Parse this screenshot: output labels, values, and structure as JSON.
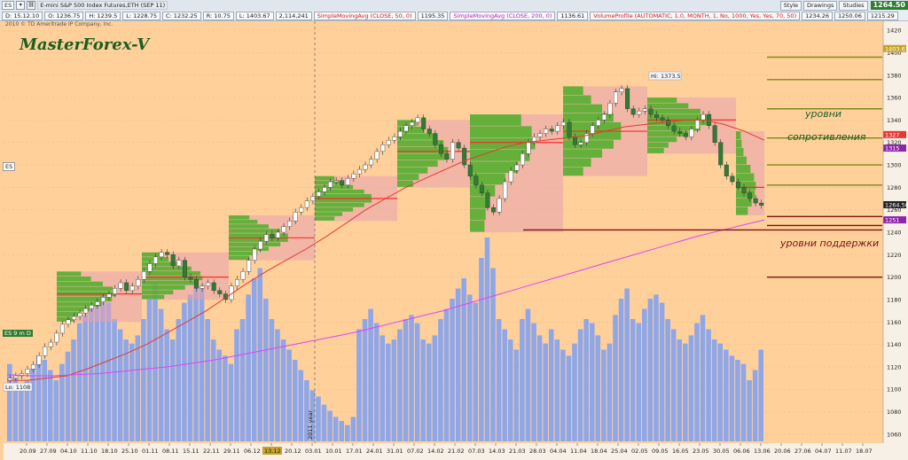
{
  "toolbar": {
    "symbol_code": "ES",
    "symbol_desc": "E-mini S&P 500 Index Futures,ETH (SEP 11)",
    "date_label": "D: 15.12.10",
    "open_label": "O: 1236.75",
    "high_label": "H: 1239.5",
    "low_label": "L: 1228.75",
    "close_label": "C: 1232.25",
    "range_label": "R: 10.75",
    "last_label": "L: 1403.67",
    "volume_value": "2,114,241",
    "sma50_study": "SimpleMovingAvg (CLOSE, 50, 0)",
    "sma50_value": "1195.35",
    "sma200_study": "SimpleMovingAvg (CLOSE, 200, 0)",
    "sma200_value": "1136.61",
    "vp_study": "VolumeProfile (AUTOMATIC, 1.0, MONTH, 1, No, 1000, Yes, Yes, 70, 50)",
    "vp_value1": "1234.26",
    "vp_value2": "1250.06",
    "vp_value3": "1215.29",
    "style_button": "Style",
    "drawings_button": "Drawings",
    "studies_button": "Studies",
    "last_price_badge": "1264.50",
    "symbol_selector": "ES",
    "timeframe_badge": "ES 9 m D",
    "copyright": "2010 © TD Ameritrade IP Company, Inc."
  },
  "overlay": {
    "brand": "MasterForex-V",
    "resistance_label_1": "уровни",
    "resistance_label_2": "сопротивления",
    "support_label": "уровни поддержки",
    "hi_label": "Hi: 1373.5",
    "lo_label": "Lo: 1108",
    "year_label": "2011 year"
  },
  "colors": {
    "background": "#ffd09a",
    "candle": "#2e7d32",
    "volume": "#8fa6e8",
    "sma50": "#e53935",
    "sma200": "#e040fb",
    "vp_green": "#4caf28",
    "vp_pink": "#e8a0b0",
    "resistance": "#7a8a1a",
    "support": "#7b1212"
  },
  "chart_data": {
    "type": "candlestick",
    "y_axis_ticks": [
      1420,
      1400,
      1380,
      1360,
      1340,
      1320,
      1300,
      1280,
      1260,
      1240,
      1220,
      1200,
      1180,
      1160,
      1140,
      1120,
      1100,
      1080,
      1060
    ],
    "ylim": [
      1052,
      1428
    ],
    "x_axis_ticks": [
      "20.09",
      "27.09",
      "04.10",
      "11.10",
      "18.10",
      "25.10",
      "01.11",
      "08.11",
      "15.11",
      "22.11",
      "29.11",
      "06.12",
      "13.12",
      "20.12",
      "03.01",
      "10.01",
      "17.01",
      "24.01",
      "31.01",
      "07.02",
      "14.02",
      "21.02",
      "07.03",
      "14.03",
      "21.03",
      "28.03",
      "04.04",
      "11.04",
      "18.04",
      "25.04",
      "02.05",
      "09.05",
      "16.05",
      "23.05",
      "30.05",
      "06.06",
      "13.06",
      "20.06",
      "27.06",
      "04.07",
      "11.07",
      "18.07"
    ],
    "highlight_tick": "13.12",
    "close_series": [
      1110,
      1112,
      1114,
      1118,
      1122,
      1130,
      1138,
      1142,
      1150,
      1158,
      1162,
      1165,
      1168,
      1172,
      1175,
      1178,
      1182,
      1185,
      1190,
      1195,
      1188,
      1192,
      1198,
      1205,
      1212,
      1218,
      1222,
      1220,
      1210,
      1215,
      1200,
      1198,
      1190,
      1192,
      1195,
      1188,
      1185,
      1180,
      1192,
      1198,
      1205,
      1215,
      1225,
      1232,
      1238,
      1235,
      1240,
      1245,
      1250,
      1258,
      1262,
      1268,
      1272,
      1276,
      1280,
      1285,
      1286,
      1282,
      1288,
      1292,
      1296,
      1300,
      1305,
      1312,
      1318,
      1322,
      1325,
      1330,
      1335,
      1338,
      1342,
      1332,
      1328,
      1318,
      1310,
      1305,
      1320,
      1315,
      1300,
      1290,
      1282,
      1275,
      1262,
      1258,
      1270,
      1285,
      1295,
      1300,
      1310,
      1320,
      1325,
      1328,
      1332,
      1330,
      1335,
      1338,
      1325,
      1318,
      1320,
      1328,
      1335,
      1340,
      1345,
      1355,
      1365,
      1368,
      1350,
      1345,
      1348,
      1350,
      1345,
      1342,
      1340,
      1335,
      1330,
      1328,
      1325,
      1332,
      1340,
      1345,
      1335,
      1320,
      1300,
      1290,
      1285,
      1280,
      1275,
      1270,
      1266,
      1264
    ],
    "sma50_series": [
      1108,
      1108,
      1110,
      1112,
      1118,
      1125,
      1132,
      1140,
      1150,
      1160,
      1170,
      1182,
      1194,
      1205,
      1215,
      1225,
      1236,
      1248,
      1260,
      1270,
      1280,
      1288,
      1296,
      1304,
      1310,
      1316,
      1320,
      1322,
      1324,
      1326,
      1330,
      1334,
      1336,
      1338,
      1340,
      1340,
      1336,
      1330,
      1322
    ],
    "sma200_series": [
      1113,
      1112,
      1112,
      1113,
      1114,
      1116,
      1118,
      1120,
      1123,
      1126,
      1130,
      1134,
      1138,
      1142,
      1146,
      1150,
      1155,
      1160,
      1165,
      1170,
      1176,
      1182,
      1188,
      1194,
      1200,
      1206,
      1212,
      1218,
      1224,
      1230,
      1236,
      1241,
      1246,
      1251
    ],
    "volume_series": [
      38,
      32,
      28,
      30,
      36,
      42,
      40,
      35,
      30,
      38,
      44,
      50,
      58,
      62,
      65,
      70,
      72,
      68,
      60,
      55,
      50,
      48,
      52,
      60,
      70,
      78,
      65,
      55,
      50,
      60,
      68,
      72,
      80,
      75,
      60,
      50,
      45,
      42,
      38,
      55,
      60,
      72,
      80,
      85,
      70,
      60,
      55,
      50,
      45,
      40,
      35,
      30,
      25,
      22,
      18,
      15,
      12,
      10,
      8,
      12,
      55,
      60,
      65,
      58,
      52,
      48,
      50,
      55,
      60,
      62,
      58,
      50,
      48,
      52,
      60,
      65,
      70,
      75,
      80,
      72,
      68,
      90,
      100,
      85,
      60,
      55,
      50,
      45,
      60,
      65,
      58,
      52,
      48,
      55,
      50,
      45,
      42,
      48,
      55,
      60,
      58,
      52,
      45,
      48,
      62,
      70,
      75,
      60,
      58,
      65,
      70,
      72,
      68,
      60,
      55,
      50,
      48,
      52,
      58,
      62,
      55,
      50,
      48,
      45,
      42,
      40,
      38,
      30,
      35,
      45
    ],
    "resistance_levels": [
      1396,
      1376,
      1350,
      1324,
      1300,
      1282
    ],
    "support_levels": [
      1254,
      1246,
      1242,
      1200
    ],
    "current_price_levels": [
      {
        "value": 1403.67,
        "label": "1403.67",
        "color": "#c9a227"
      },
      {
        "value": 1327,
        "label": "1327",
        "color": "#e53935"
      },
      {
        "value": 1315,
        "label": "1315",
        "color": "#8e24aa"
      },
      {
        "value": 1264.5,
        "label": "1264.50",
        "color": "#222222"
      },
      {
        "value": 1251,
        "label": "1251",
        "color": "#8e24aa"
      }
    ],
    "volume_profiles": [
      {
        "x_start": 64,
        "x_end": 160,
        "lo": 1160,
        "hi": 1205,
        "poc": 1185
      },
      {
        "x_start": 160,
        "x_end": 258,
        "lo": 1180,
        "hi": 1222,
        "poc": 1200
      },
      {
        "x_start": 258,
        "x_end": 355,
        "lo": 1215,
        "hi": 1255,
        "poc": 1235
      },
      {
        "x_start": 355,
        "x_end": 448,
        "lo": 1250,
        "hi": 1290,
        "poc": 1270
      },
      {
        "x_start": 448,
        "x_end": 530,
        "lo": 1280,
        "hi": 1340,
        "poc": 1312
      },
      {
        "x_start": 530,
        "x_end": 635,
        "lo": 1240,
        "hi": 1345,
        "poc": 1320
      },
      {
        "x_start": 635,
        "x_end": 730,
        "lo": 1290,
        "hi": 1370,
        "poc": 1330
      },
      {
        "x_start": 730,
        "x_end": 830,
        "lo": 1310,
        "hi": 1360,
        "poc": 1340
      },
      {
        "x_start": 830,
        "x_end": 862,
        "lo": 1255,
        "hi": 1330,
        "poc": 1280
      }
    ]
  }
}
